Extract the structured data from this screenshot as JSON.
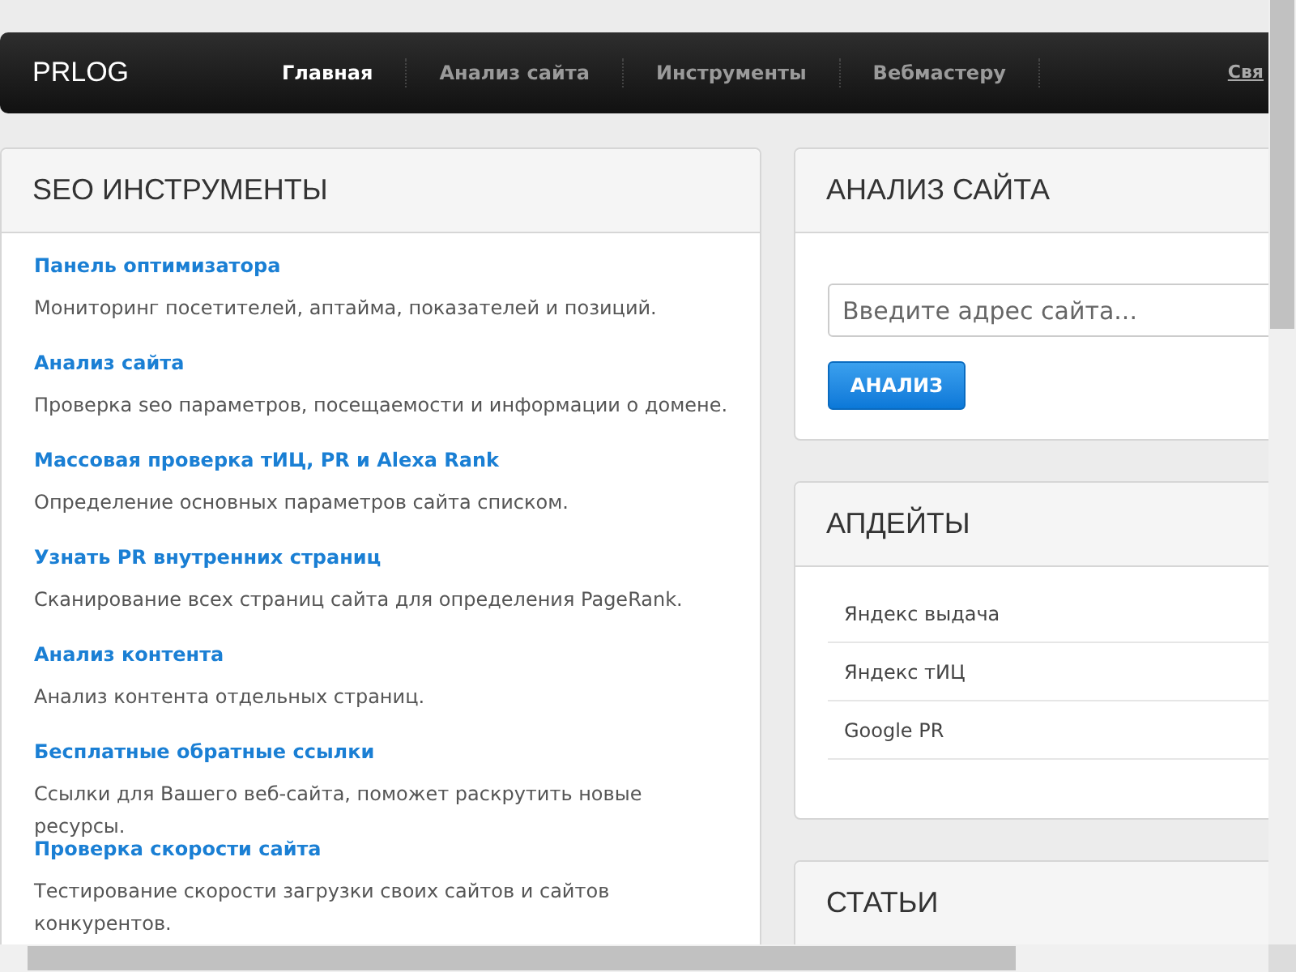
{
  "navbar": {
    "logo": "PRLOG",
    "items": [
      {
        "label": "Главная",
        "selected": true
      },
      {
        "label": "Анализ сайта",
        "selected": false
      },
      {
        "label": "Инструменты",
        "selected": false
      },
      {
        "label": "Вебмастеру",
        "selected": false
      }
    ],
    "link": "Свя"
  },
  "tools_panel": {
    "title": "SEO ИНСТРУМЕНТЫ",
    "items": [
      {
        "title": "Панель оптимизатора",
        "description": "Мониторинг посетителей, аптайма, показателей и позиций."
      },
      {
        "title": "Анализ сайта",
        "description": "Проверка seo параметров, посещаемости и информации о домене."
      },
      {
        "title": "Массовая проверка тИЦ, PR и Alexa Rank",
        "description": "Определение основных параметров сайта списком."
      },
      {
        "title": "Узнать PR внутренних страниц",
        "description": "Сканирование всех страниц сайта для определения PageRank."
      },
      {
        "title": "Анализ контента",
        "description": "Анализ контента отдельных страниц."
      },
      {
        "title": "Бесплатные обратные ссылки",
        "description": "Ссылки для Вашего веб-сайта, поможет раскрутить новые ресурсы."
      },
      {
        "title": "Проверка скорости сайта",
        "description": "Тестирование скорости загрузки своих сайтов и сайтов конкурентов."
      }
    ]
  },
  "analysis_panel": {
    "title": "АНАЛИЗ САЙТА",
    "placeholder": "Введите адрес сайта...",
    "button": "АНАЛИЗ"
  },
  "updates_panel": {
    "title": "АПДЕЙТЫ",
    "items": [
      "Яндекс выдача",
      "Яндекс тИЦ",
      "Google PR"
    ]
  },
  "articles_panel": {
    "title": "СТАТЬИ"
  }
}
